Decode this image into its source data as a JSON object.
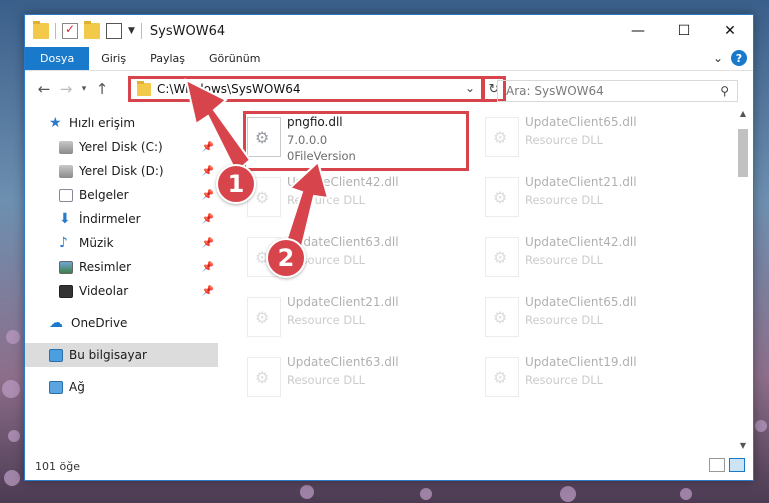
{
  "window": {
    "title": "SysWOW64",
    "controls": {
      "minimize": "—",
      "maximize": "☐",
      "close": "✕"
    }
  },
  "ribbon": {
    "tabs": [
      {
        "label": "Dosya",
        "active": true
      },
      {
        "label": "Giriş"
      },
      {
        "label": "Paylaş"
      },
      {
        "label": "Görünüm"
      }
    ]
  },
  "nav": {
    "back": "←",
    "forward": "→",
    "recent": "▾",
    "up": "↑",
    "address_path": "C:\\Windows\\SysWOW64",
    "refresh": "↻",
    "search_placeholder": "Ara: SysWOW64",
    "search_icon": "search-icon"
  },
  "sidebar": {
    "items": [
      {
        "label": "Hızlı erişim",
        "icon": "star-icon",
        "pinned": false
      },
      {
        "label": "Yerel Disk (C:)",
        "icon": "disk-icon",
        "pinned": true
      },
      {
        "label": "Yerel Disk (D:)",
        "icon": "disk-icon",
        "pinned": true
      },
      {
        "label": "Belgeler",
        "icon": "documents-icon",
        "pinned": true
      },
      {
        "label": "İndirmeler",
        "icon": "downloads-icon",
        "pinned": true
      },
      {
        "label": "Müzik",
        "icon": "music-icon",
        "pinned": true
      },
      {
        "label": "Resimler",
        "icon": "pictures-icon",
        "pinned": true
      },
      {
        "label": "Videolar",
        "icon": "videos-icon",
        "pinned": true
      },
      {
        "label": "OneDrive",
        "icon": "onedrive-icon"
      },
      {
        "label": "Bu bilgisayar",
        "icon": "this-pc-icon",
        "selected": true
      },
      {
        "label": "Ağ",
        "icon": "network-icon"
      }
    ]
  },
  "files": [
    {
      "name": "pngfio.dll",
      "line1": "7.0.0.0",
      "line2": "0FileVersion",
      "highlighted": true
    },
    {
      "name": "UpdateClient65.dll",
      "line1": "Resource DLL"
    },
    {
      "name": "UpdateClient42.dll",
      "line1": "Resource DLL"
    },
    {
      "name": "UpdateClient21.dll",
      "line1": "Resource DLL"
    },
    {
      "name": "UpdateClient63.dll",
      "line1": "Resource DLL"
    },
    {
      "name": "UpdateClient42.dll",
      "line1": "Resource DLL"
    },
    {
      "name": "UpdateClient21.dll",
      "line1": "Resource DLL"
    },
    {
      "name": "UpdateClient65.dll",
      "line1": "Resource DLL"
    },
    {
      "name": "UpdateClient63.dll",
      "line1": "Resource DLL"
    },
    {
      "name": "UpdateClient19.dll",
      "line1": "Resource DLL"
    }
  ],
  "status": {
    "item_count": "101 öğe"
  },
  "callouts": {
    "one": "1",
    "two": "2"
  },
  "colors": {
    "accent": "#1979ca",
    "callout": "#d8444b"
  }
}
